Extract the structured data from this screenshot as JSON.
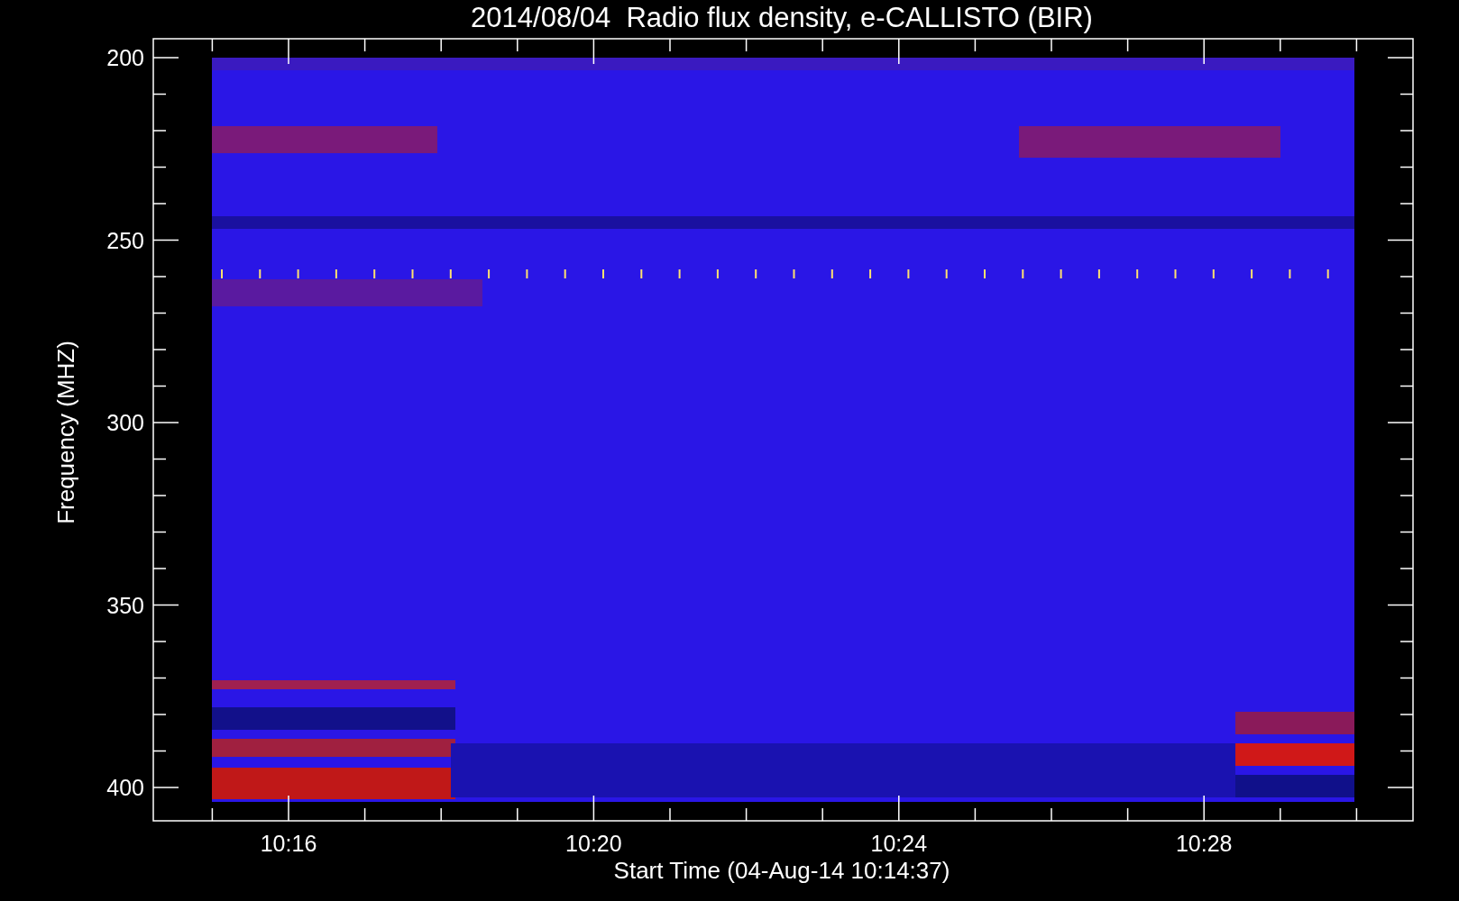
{
  "title": "2014/08/04  Radio flux density, e-CALLISTO (BIR)",
  "y_axis": {
    "label": "Frequency (MHZ)",
    "ticks": [
      "200",
      "250",
      "300",
      "350",
      "400"
    ]
  },
  "x_axis": {
    "label": "Start Time (04-Aug-14 10:14:37)",
    "ticks": [
      "10:16",
      "10:20",
      "10:24",
      "10:28"
    ]
  }
}
